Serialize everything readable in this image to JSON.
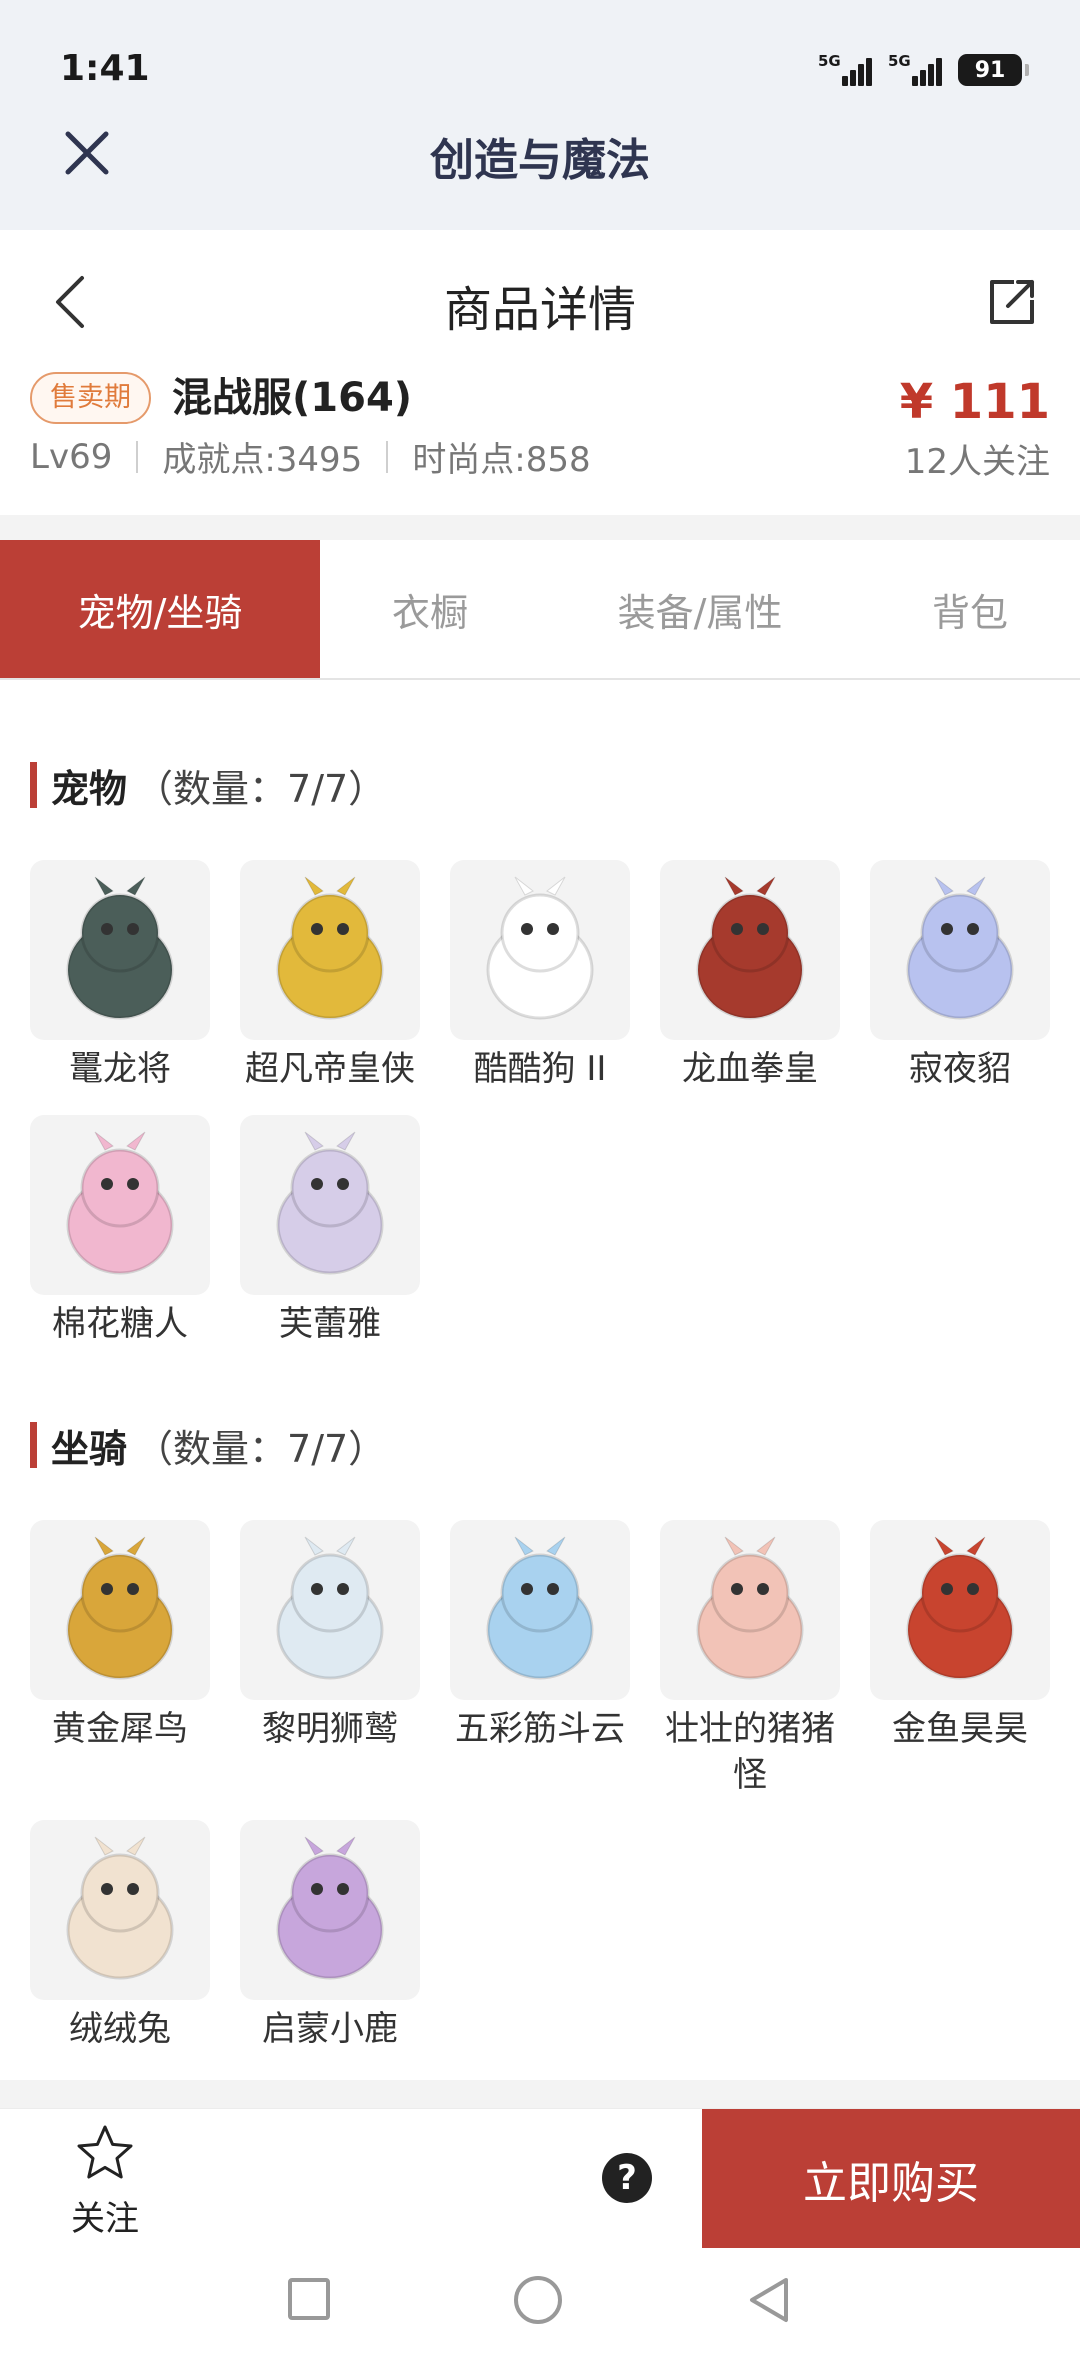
{
  "status_bar": {
    "time": "1:41",
    "battery": "91",
    "network": "5G"
  },
  "app": {
    "title": "创造与魔法"
  },
  "detail": {
    "title": "商品详情"
  },
  "product": {
    "badge": "售卖期",
    "server": "混战服(164)",
    "price": "¥ 111",
    "level": "Lv69",
    "achievement": "成就点:3495",
    "fashion": "时尚点:858",
    "followers": "12人关注"
  },
  "tabs": [
    {
      "label": "宠物/坐骑",
      "active": true
    },
    {
      "label": "衣橱",
      "active": false
    },
    {
      "label": "装备/属性",
      "active": false
    },
    {
      "label": "背包",
      "active": false
    }
  ],
  "pets": {
    "name": "宠物",
    "count": "（数量：7/7）",
    "items": [
      {
        "label": "鼍龙将",
        "color": "#4b5e59"
      },
      {
        "label": "超凡帝皇侠",
        "color": "#e2b93b"
      },
      {
        "label": "酷酷狗 II",
        "color": "#ffffff"
      },
      {
        "label": "龙血拳皇",
        "color": "#a63a2d"
      },
      {
        "label": "寂夜貂",
        "color": "#b8c2ef"
      },
      {
        "label": "棉花糖人",
        "color": "#f1b7cf"
      },
      {
        "label": "芙蕾雅",
        "color": "#d6cde8"
      }
    ]
  },
  "mounts": {
    "name": "坐骑",
    "count": "（数量：7/7）",
    "items": [
      {
        "label": "黄金犀鸟",
        "color": "#d9a63a"
      },
      {
        "label": "黎明狮鹫",
        "color": "#dfeaf2"
      },
      {
        "label": "五彩筋斗云",
        "color": "#a9d2ef"
      },
      {
        "label": "壮壮的猪猪怪",
        "color": "#f2c3b7"
      },
      {
        "label": "金鱼昊昊",
        "color": "#c8442f"
      },
      {
        "label": "绒绒兔",
        "color": "#f1e2d0"
      },
      {
        "label": "启蒙小鹿",
        "color": "#c7a6dc"
      }
    ]
  },
  "bottom": {
    "follow_label": "关注",
    "help": "?",
    "buy_label": "立即购买"
  }
}
